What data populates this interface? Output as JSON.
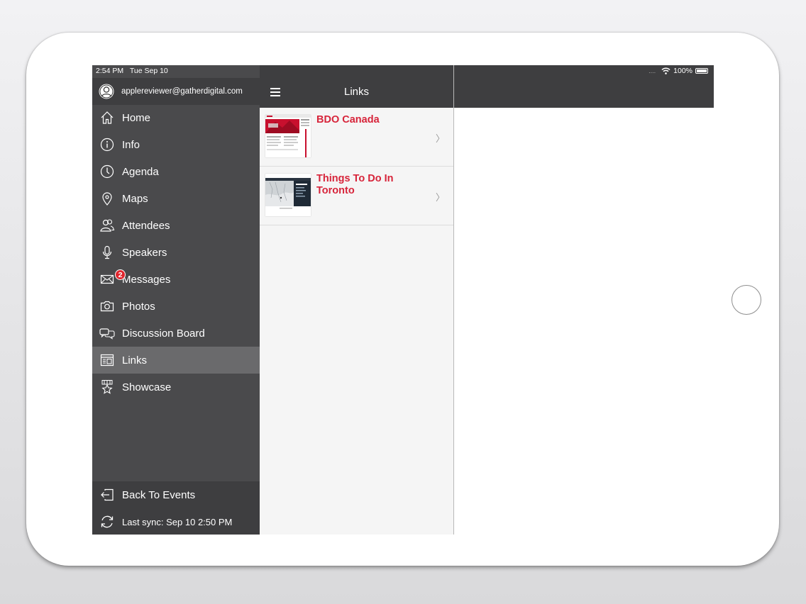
{
  "status_bar": {
    "time": "2:54 PM",
    "date": "Tue Sep 10",
    "battery_percent": "100%",
    "signal_dots": "....",
    "battery_level": 1.0
  },
  "sidebar": {
    "user_email": "applereviewer@gatherdigital.com",
    "items": [
      {
        "label": "Home",
        "icon": "home-icon"
      },
      {
        "label": "Info",
        "icon": "info-icon"
      },
      {
        "label": "Agenda",
        "icon": "clock-icon"
      },
      {
        "label": "Maps",
        "icon": "map-pin-icon"
      },
      {
        "label": "Attendees",
        "icon": "people-icon"
      },
      {
        "label": "Speakers",
        "icon": "microphone-icon"
      },
      {
        "label": "Messages",
        "icon": "envelope-icon",
        "badge": "2"
      },
      {
        "label": "Photos",
        "icon": "camera-icon"
      },
      {
        "label": "Discussion Board",
        "icon": "chat-bubbles-icon"
      },
      {
        "label": "Links",
        "icon": "browser-window-icon",
        "active": true
      },
      {
        "label": "Showcase",
        "icon": "star-badge-icon"
      }
    ],
    "footer": {
      "back_label": "Back To Events",
      "sync_label": "Last sync:  Sep 10 2:50 PM"
    }
  },
  "links_panel": {
    "title": "Links",
    "items": [
      {
        "title": "BDO Canada",
        "thumbnail": "bdo-website-thumbnail"
      },
      {
        "title": "Things To Do In Toronto",
        "thumbnail": "toronto-map-thumbnail"
      }
    ]
  },
  "colors": {
    "sidebar_bg": "#4a4a4c",
    "header_bg": "#3e3e40",
    "active_item_bg": "#6a6a6c",
    "accent_red": "#d7243a",
    "badge_red": "#e0262e"
  }
}
